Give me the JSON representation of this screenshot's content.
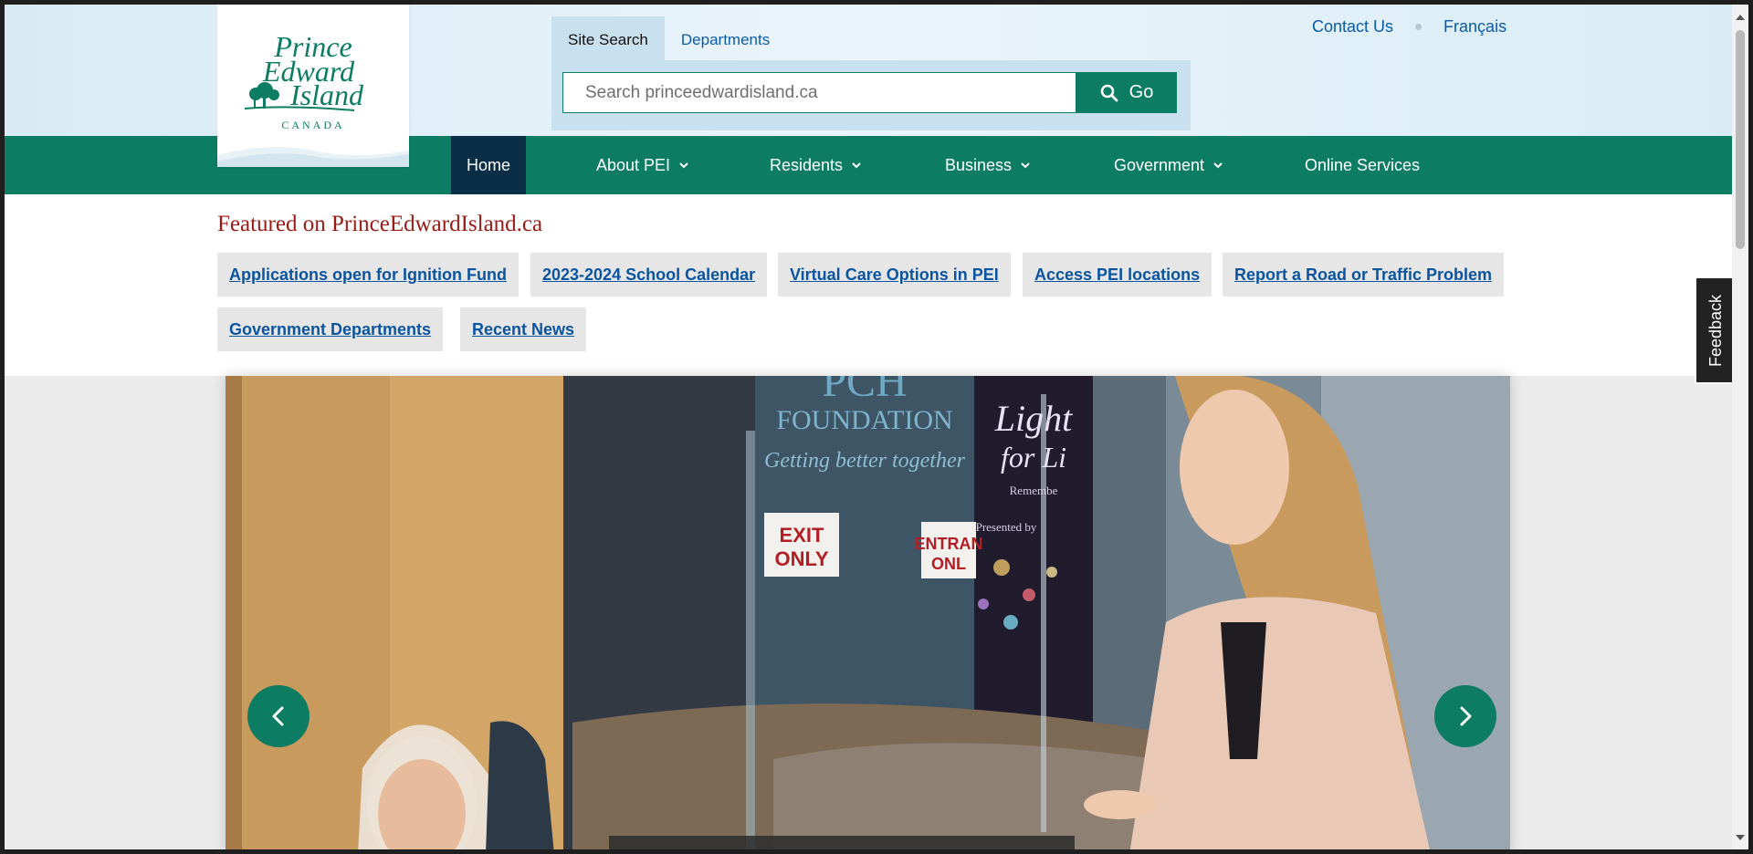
{
  "colors": {
    "brand_green": "#0c7c63",
    "nav_active": "#0a2e45",
    "link_blue": "#0b5aa8",
    "featured_title_red": "#9b1b14",
    "header_bg": "#d8ebf5"
  },
  "logo": {
    "line1": "Prince",
    "line2": "Edward",
    "line3": "Island",
    "country": "CANADA"
  },
  "search": {
    "tabs": [
      "Site Search",
      "Departments"
    ],
    "active_tab": "Site Search",
    "placeholder": "Search princeedwardisland.ca",
    "button_label": "Go",
    "button_icon": "search-icon"
  },
  "utility": {
    "contact": "Contact Us",
    "language": "Français"
  },
  "nav": {
    "items": [
      {
        "label": "Home",
        "active": true,
        "dropdown": false
      },
      {
        "label": "About PEI",
        "active": false,
        "dropdown": true
      },
      {
        "label": "Residents",
        "active": false,
        "dropdown": true
      },
      {
        "label": "Business",
        "active": false,
        "dropdown": true
      },
      {
        "label": "Government",
        "active": false,
        "dropdown": true
      },
      {
        "label": "Online Services",
        "active": false,
        "dropdown": false
      }
    ]
  },
  "featured": {
    "title": "Featured on PrinceEdwardIsland.ca",
    "links": [
      "Applications open for Ignition Fund",
      "2023-2024 School Calendar",
      "Virtual Care Options in PEI",
      "Access PEI locations",
      "Report a Road or Traffic Problem",
      "Government Departments",
      "Recent News"
    ]
  },
  "carousel": {
    "photo_signs": {
      "foundation_top": "PCH",
      "foundation": "FOUNDATION",
      "tagline": "Getting better together",
      "exit_1": "EXIT",
      "exit_2": "ONLY",
      "entrance_1": "ENTRAN",
      "entrance_2": "ONL",
      "banner_script": "Light",
      "banner_script_2": "for Li",
      "banner_small": "Remembe",
      "banner_presented": "Presented by"
    },
    "prev_icon": "chevron-left-icon",
    "next_icon": "chevron-right-icon"
  },
  "feedback": {
    "label": "Feedback"
  }
}
